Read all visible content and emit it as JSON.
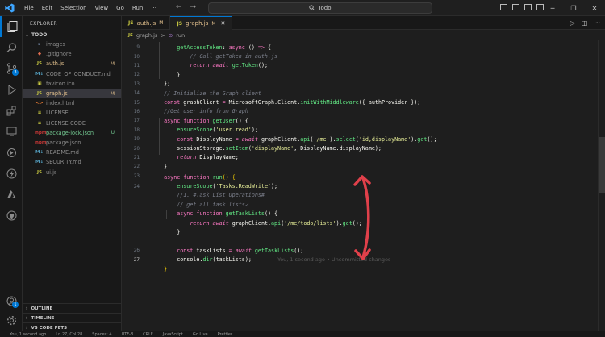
{
  "titlebar": {
    "menu": [
      "File",
      "Edit",
      "Selection",
      "View",
      "Go",
      "Run"
    ],
    "more": "···",
    "search_text": "Todo"
  },
  "sidebar": {
    "title": "EXPLORER",
    "more": "···",
    "folder": "TODO",
    "files": [
      {
        "name": "images",
        "icon": "folder",
        "status": "",
        "kind": "ignored"
      },
      {
        "name": ".gitignore",
        "icon": "git",
        "status": "",
        "kind": "ignored"
      },
      {
        "name": "auth.js",
        "icon": "js",
        "status": "M",
        "kind": "mod"
      },
      {
        "name": "CODE_OF_CONDUCT.md",
        "icon": "md",
        "status": "",
        "kind": "ignored"
      },
      {
        "name": "favicon.ico",
        "icon": "ico",
        "status": "",
        "kind": "ignored"
      },
      {
        "name": "graph.js",
        "icon": "js",
        "status": "M",
        "kind": "mod sel"
      },
      {
        "name": "index.html",
        "icon": "html",
        "status": "",
        "kind": "ignored"
      },
      {
        "name": "LICENSE",
        "icon": "license",
        "status": "",
        "kind": "ignored"
      },
      {
        "name": "LICENSE-CODE",
        "icon": "license",
        "status": "",
        "kind": "ignored"
      },
      {
        "name": "package-lock.json",
        "icon": "npm",
        "status": "U",
        "kind": "untr"
      },
      {
        "name": "package.json",
        "icon": "npm",
        "status": "",
        "kind": "ignored"
      },
      {
        "name": "README.md",
        "icon": "md",
        "status": "",
        "kind": "ignored"
      },
      {
        "name": "SECURITY.md",
        "icon": "md",
        "status": "",
        "kind": "ignored"
      },
      {
        "name": "ui.js",
        "icon": "js",
        "status": "",
        "kind": "ignored"
      }
    ],
    "outline": "OUTLINE",
    "timeline": "TIMELINE",
    "pets": "VS CODE PETS"
  },
  "tabs": [
    {
      "label": "auth.js",
      "status": "M",
      "active": false
    },
    {
      "label": "graph.js",
      "status": "M",
      "active": true
    }
  ],
  "breadcrumb": {
    "file": "graph.js",
    "sep": ">",
    "symbol": "run"
  },
  "editor": {
    "ghost_blame": "You, 1 second ago • Uncommitted changes",
    "active_line": 27
  },
  "status_bar": [
    "You, 1 second ago",
    "Ln 27, Col 28",
    "Spaces: 4",
    "UTF-8",
    "CRLF",
    "JavaScript",
    "Go Live",
    "Prettier"
  ]
}
